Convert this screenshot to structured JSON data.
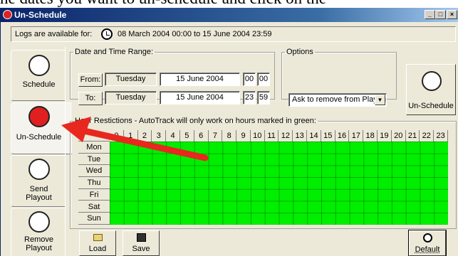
{
  "page_text": "ne dates you want to un-schedule and click on the",
  "window": {
    "title": "Un-Schedule",
    "title_buttons": [
      "_",
      "□",
      "×"
    ]
  },
  "logs": {
    "label": "Logs are available for:",
    "icon": "clock-icon",
    "range": "08 March 2004 00:00  to  15 June 2004 23:59"
  },
  "tabs": [
    {
      "label": "Schedule",
      "icon": "schedule-icon",
      "active": false
    },
    {
      "label": "Un-Schedule",
      "icon": "unschedule-icon",
      "active": true
    },
    {
      "label": "Send\nPlayout",
      "icon": "send-playout-icon",
      "active": false
    },
    {
      "label": "Remove\nPlayout",
      "icon": "remove-playout-icon",
      "active": false
    }
  ],
  "date_range": {
    "legend": "Date and Time Range:",
    "from": {
      "label": "From:",
      "day": "Tuesday",
      "date": "15 June 2004",
      "hour": "00",
      "minute": "00"
    },
    "to": {
      "label": "To:",
      "day": "Tuesday",
      "date": "15 June 2004",
      "hour": "23",
      "minute": "59"
    }
  },
  "options": {
    "legend": "Options",
    "select_value": "Ask to remove from Playou"
  },
  "unschedule_button": {
    "label": "Un-Schedule",
    "icon": "unschedule-icon"
  },
  "hour_restrictions": {
    "legend": "Hour Restictions - AutoTrack  will only work on hours marked in green:",
    "hours": [
      "0",
      "1",
      "2",
      "3",
      "4",
      "5",
      "6",
      "7",
      "8",
      "9",
      "10",
      "11",
      "12",
      "13",
      "14",
      "15",
      "16",
      "17",
      "18",
      "19",
      "20",
      "21",
      "22",
      "23"
    ],
    "days": [
      "Mon",
      "Tue",
      "Wed",
      "Thu",
      "Fri",
      "Sat",
      "Sun"
    ],
    "active_color": "#00ee00"
  },
  "bottom_buttons": {
    "load": {
      "label": "Load",
      "icon": "folder-icon"
    },
    "save": {
      "label": "Save",
      "icon": "floppy-disk-icon"
    },
    "default": {
      "label": "Default",
      "icon": "clock-icon"
    }
  },
  "annotation": {
    "color": "#e8281e",
    "icon": "red-arrow-annotation"
  }
}
